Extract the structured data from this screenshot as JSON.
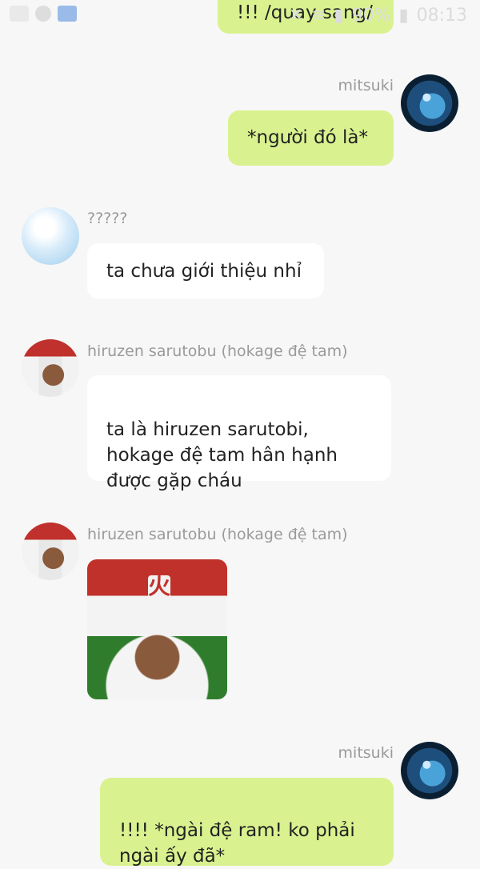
{
  "status_bar": {
    "battery": "90%",
    "time": "08:13"
  },
  "messages": [
    {
      "id": "m0",
      "side": "me",
      "text": "!!! /quay sang/"
    },
    {
      "id": "m1",
      "side": "me",
      "sender": "mitsuki",
      "text": "*người đó là*"
    },
    {
      "id": "m2",
      "side": "them",
      "sender": "?????",
      "text": "ta chưa giới thiệu nhỉ"
    },
    {
      "id": "m3",
      "side": "them",
      "sender": "hiruzen sarutobu (hokage đệ tam)",
      "text": "ta là hiruzen sarutobi,\nhokage đệ tam hân hạnh\nđược gặp cháu"
    },
    {
      "id": "m4",
      "side": "them",
      "sender": "hiruzen sarutobu (hokage đệ tam)",
      "sticker": "hokage-portrait"
    },
    {
      "id": "m5",
      "side": "me",
      "sender": "mitsuki",
      "text": "!!!! *ngài đệ ram! ko phải\nngài ấy đã*"
    }
  ]
}
